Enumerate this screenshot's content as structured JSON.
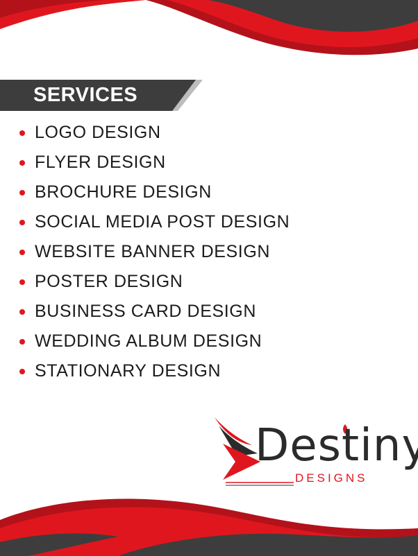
{
  "header": {
    "title": "SERVICES"
  },
  "services": [
    "LOGO DESIGN",
    "FLYER DESIGN",
    "BROCHURE DESIGN",
    "SOCIAL MEDIA POST DESIGN",
    "WEBSITE BANNER DESIGN",
    "POSTER DESIGN",
    "BUSINESS CARD DESIGN",
    "WEDDING ALBUM DESIGN",
    "STATIONARY DESIGN"
  ],
  "logo": {
    "main": "Destiny",
    "sub": "DESIGNS"
  },
  "colors": {
    "accent": "#e0161e",
    "dark": "#3a3a3a",
    "text": "#1b1b1b"
  }
}
